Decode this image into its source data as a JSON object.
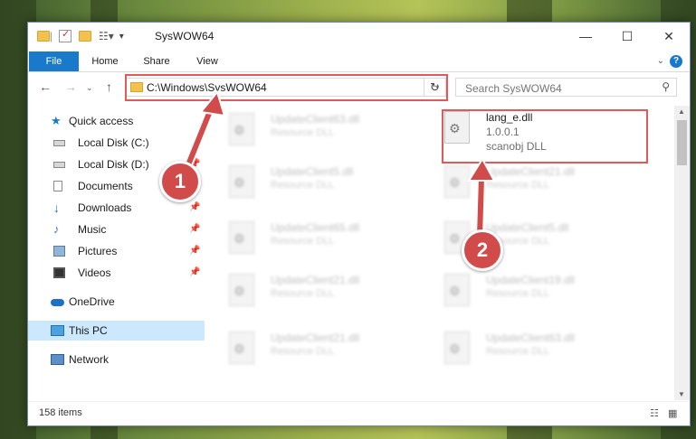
{
  "window": {
    "title": "SysWOW64",
    "minimize": "—",
    "maximize": "☐",
    "close": "✕"
  },
  "ribbon": {
    "tabs": [
      "File",
      "Home",
      "Share",
      "View"
    ],
    "help": "?"
  },
  "address": {
    "path": "C:\\Windows\\SysWOW64",
    "search_placeholder": "Search SysWOW64"
  },
  "sidebar": {
    "items": [
      {
        "label": "Quick access",
        "icon": "star-icon"
      },
      {
        "label": "Local Disk (C:)",
        "icon": "drive-icon"
      },
      {
        "label": "Local Disk (D:)",
        "icon": "drive-icon"
      },
      {
        "label": "Documents",
        "icon": "documents-icon"
      },
      {
        "label": "Downloads",
        "icon": "download-icon"
      },
      {
        "label": "Music",
        "icon": "music-icon"
      },
      {
        "label": "Pictures",
        "icon": "pictures-icon"
      },
      {
        "label": "Videos",
        "icon": "videos-icon"
      },
      {
        "label": "OneDrive",
        "icon": "cloud-icon"
      },
      {
        "label": "This PC",
        "icon": "computer-icon"
      },
      {
        "label": "Network",
        "icon": "network-icon"
      }
    ]
  },
  "files": {
    "left": [
      {
        "name": "UpdateClient63.dll",
        "type": "Resource DLL"
      },
      {
        "name": "UpdateClient5.dll",
        "type": "Resource DLL"
      },
      {
        "name": "UpdateClient65.dll",
        "type": "Resource DLL"
      },
      {
        "name": "UpdateClient21.dll",
        "type": "Resource DLL"
      },
      {
        "name": "UpdateClient21.dll",
        "type": "Resource DLL"
      }
    ],
    "right": [
      {
        "name": "UpdateClient21.dll",
        "type": "Resource DLL"
      },
      {
        "name": "UpdateClient5.dll",
        "type": "Resource DLL"
      },
      {
        "name": "UpdateClient19.dll",
        "type": "Resource DLL"
      },
      {
        "name": "UpdateClient63.dll",
        "type": "Resource DLL"
      }
    ],
    "highlighted": {
      "name": "lang_e.dll",
      "version": "1.0.0.1",
      "type": "scanobj DLL"
    }
  },
  "status": {
    "count": "158 items"
  },
  "callouts": [
    "1",
    "2"
  ],
  "colors": {
    "accent": "#1979ca",
    "callout": "#d24b4b",
    "highlight_box": "#e05a5a"
  }
}
